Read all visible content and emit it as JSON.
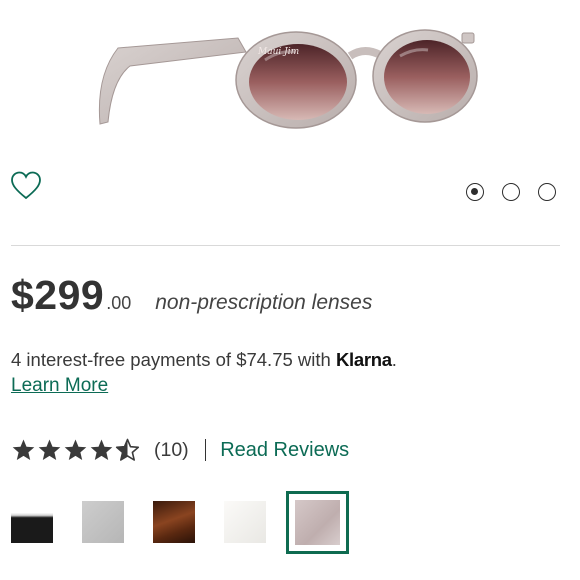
{
  "product_image": {
    "alt": "sunglasses",
    "brand_mark": "Maui Jim"
  },
  "gallery": {
    "dot_count": 3,
    "active_index": 0
  },
  "price": {
    "dollars": "$299",
    "cents": ".00",
    "lens_note": "non-prescription lenses"
  },
  "klarna": {
    "text_before": "4 interest-free payments of $74.75 with ",
    "brand": "Klarna",
    "text_after": ".",
    "learn_more": "Learn More"
  },
  "rating": {
    "value": 4.5,
    "max": 5,
    "count_label": "(10)",
    "read_reviews": "Read Reviews"
  },
  "swatches": [
    {
      "name": "black-white",
      "colors": [
        "#ffffff",
        "#1a1a1a"
      ],
      "selected": false
    },
    {
      "name": "grey",
      "colors": [
        "#c4c4c4",
        "#b8b8b8"
      ],
      "selected": false
    },
    {
      "name": "tortoise",
      "colors": [
        "#7a3b1c",
        "#3a1a0c"
      ],
      "selected": false
    },
    {
      "name": "white",
      "colors": [
        "#f6f5f2",
        "#ecebe7"
      ],
      "selected": false
    },
    {
      "name": "translucent-rose",
      "colors": [
        "#cdbfbf",
        "#bba9a9"
      ],
      "selected": true
    }
  ],
  "colors": {
    "accent": "#0c6b55",
    "selected_border": "#0e6b50",
    "heart": "#0c6b55"
  }
}
